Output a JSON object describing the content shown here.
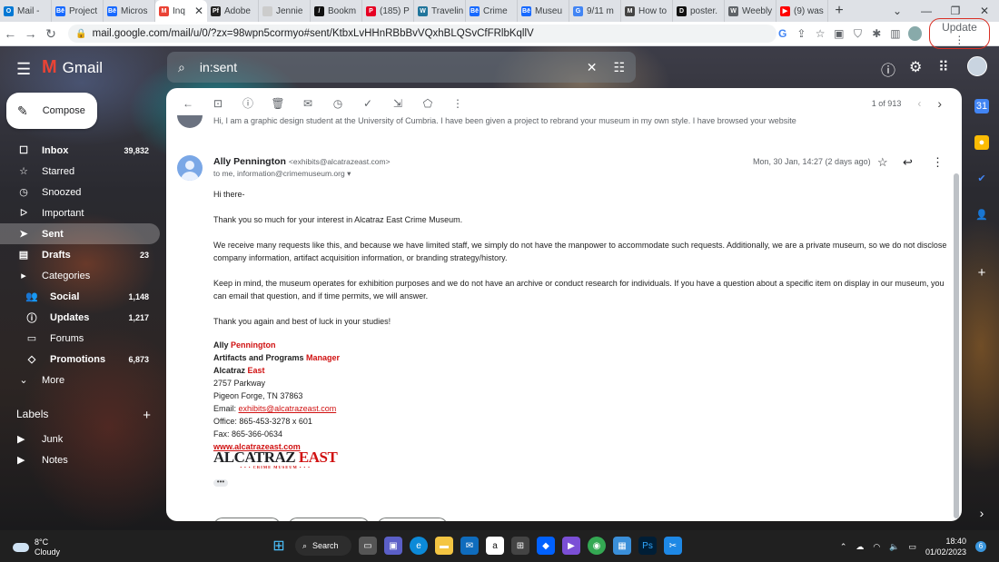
{
  "browser": {
    "tabs": [
      {
        "label": "Mail - ",
        "fav": "O",
        "color": "#0078d4"
      },
      {
        "label": "Project",
        "fav": "Bē",
        "color": "#1769ff"
      },
      {
        "label": "Micros",
        "fav": "Bē",
        "color": "#1769ff"
      },
      {
        "label": "Inq",
        "fav": "M",
        "color": "#ea4335",
        "active": true
      },
      {
        "label": "Adobe",
        "fav": "Pf",
        "color": "#222"
      },
      {
        "label": "Jennie",
        "fav": "",
        "color": "#cccccc"
      },
      {
        "label": "Bookm",
        "fav": "/",
        "color": "#111"
      },
      {
        "label": "(185) P",
        "fav": "P",
        "color": "#e60023"
      },
      {
        "label": "Travelin",
        "fav": "W",
        "color": "#21759b"
      },
      {
        "label": "Crime",
        "fav": "Bē",
        "color": "#1769ff"
      },
      {
        "label": "Museu",
        "fav": "Bē",
        "color": "#1769ff"
      },
      {
        "label": "9/11 m",
        "fav": "G",
        "color": "#4285f4"
      },
      {
        "label": "How to",
        "fav": "M",
        "color": "#444"
      },
      {
        "label": "poster.",
        "fav": "D",
        "color": "#111"
      },
      {
        "label": "Weebly",
        "fav": "W",
        "color": "#5f6368"
      },
      {
        "label": "(9) was",
        "fav": "▶",
        "color": "#ff0000"
      }
    ],
    "url": "mail.google.com/mail/u/0/?zx=98wpn5cormyo#sent/KtbxLvHHnRBbBvVQxhBLQSvCfFRlbKqllV",
    "update_label": "Update"
  },
  "gmail": {
    "logo_text": "Gmail",
    "search_query": "in:sent",
    "compose_label": "Compose",
    "nav": [
      {
        "label": "Inbox",
        "count": "39,832",
        "icon": "inbox-icon",
        "glyph": "☐",
        "bold": true
      },
      {
        "label": "Starred",
        "count": "",
        "icon": "star-icon",
        "glyph": "☆"
      },
      {
        "label": "Snoozed",
        "count": "",
        "icon": "clock-icon",
        "glyph": "◷"
      },
      {
        "label": "Important",
        "count": "",
        "icon": "important-icon",
        "glyph": "ᐅ"
      },
      {
        "label": "Sent",
        "count": "",
        "icon": "send-icon",
        "glyph": "➤",
        "selected": true
      },
      {
        "label": "Drafts",
        "count": "23",
        "icon": "draft-icon",
        "glyph": "▤",
        "bold": true
      },
      {
        "label": "Categories",
        "count": "",
        "icon": "label-icon",
        "glyph": "▸",
        "expand": true
      },
      {
        "label": "Social",
        "count": "1,148",
        "icon": "people-icon",
        "glyph": "👥",
        "bold": true,
        "sub": true
      },
      {
        "label": "Updates",
        "count": "1,217",
        "icon": "info-icon",
        "glyph": "ⓘ",
        "bold": true,
        "sub": true
      },
      {
        "label": "Forums",
        "count": "",
        "icon": "forum-icon",
        "glyph": "▭",
        "sub": true
      },
      {
        "label": "Promotions",
        "count": "6,873",
        "icon": "tag-icon",
        "glyph": "◇",
        "bold": true,
        "sub": true
      },
      {
        "label": "More",
        "count": "",
        "icon": "chevron-down-icon",
        "glyph": "⌄"
      }
    ],
    "labels_heading": "Labels",
    "labels": [
      "Junk",
      "Notes"
    ],
    "pager": "1 of 913"
  },
  "message": {
    "prev_snippet": "Hi, I am a graphic design student at the University of Cumbria. I have been given a project to rebrand your museum in my own style. I have browsed your website",
    "sender_name": "Ally Pennington",
    "sender_email": "<exhibits@alcatrazeast.com>",
    "to_line": "to me, information@crimemuseum.org",
    "date": "Mon, 30 Jan, 14:27 (2 days ago)",
    "paragraphs": [
      "Hi there-",
      "Thank you so much for your interest in Alcatraz East Crime Museum.",
      "We receive many requests like this, and because we have limited staff, we simply do not have the manpower to accommodate such requests. Additionally, we are a private museum, so we do not disclose company information, artifact acquisition information, or branding strategy/history.",
      "Keep in mind, the museum operates for exhibition purposes and we do not have an archive or conduct research for individuals. If you have a question about a specific item on display in our museum, you can email that question, and if time permits, we will answer.",
      "Thank you again and best of luck in your studies!"
    ],
    "signature": {
      "name_first": "Ally ",
      "name_last": "Pennington",
      "title_main": "Artifacts and Programs ",
      "title_accent": "Manager",
      "org_main": "Alcatraz ",
      "org_accent": "East",
      "address1": "2757 Parkway",
      "address2": "Pigeon Forge, TN 37863",
      "email_label": "Email: ",
      "email": "exhibits@alcatrazeast.com",
      "office": "Office: 865-453-3278 x 601",
      "fax": "Fax: 865-366-0634",
      "website": "www.alcatrazeast.com",
      "logo_main": "ALCATRAZ ",
      "logo_accent": "EAST",
      "logo_tagline": "• • • CRIME MUSEUM • • •"
    }
  },
  "taskbar": {
    "temp": "8°C",
    "weather": "Cloudy",
    "search_label": "Search",
    "time": "18:40",
    "date": "01/02/2023",
    "notif_count": "6"
  }
}
